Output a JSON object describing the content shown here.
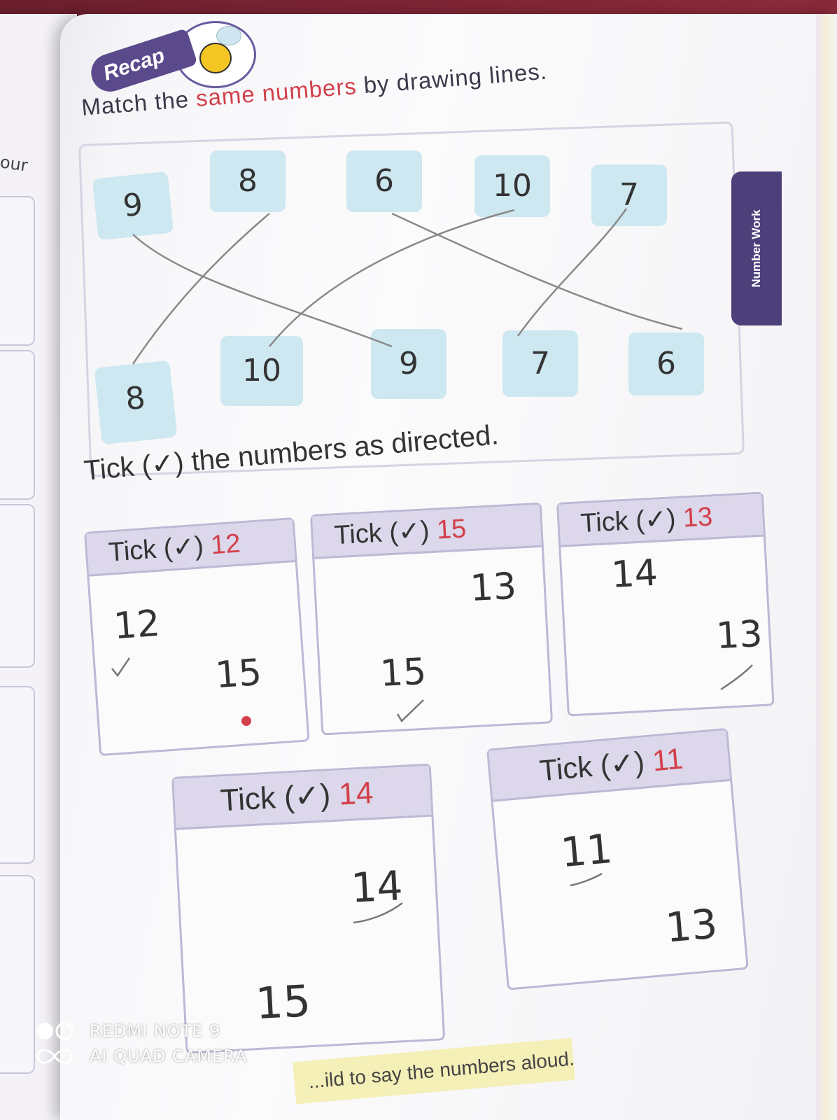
{
  "recap": {
    "label": "Recap"
  },
  "instruction": {
    "part1": "Match the ",
    "highlight": "same numbers",
    "part2": " by drawing lines."
  },
  "match_top": [
    "9",
    "8",
    "6",
    "10",
    "7"
  ],
  "match_bottom": [
    "8",
    "10",
    "9",
    "7",
    "6"
  ],
  "tick_title": "Tick (✓) the numbers as directed.",
  "tick_boxes": [
    {
      "head": "Tick (✓)",
      "target": "12",
      "numbers": [
        "12",
        "15"
      ]
    },
    {
      "head": "Tick (✓)",
      "target": "15",
      "numbers": [
        "13",
        "15"
      ]
    },
    {
      "head": "Tick (✓)",
      "target": "13",
      "numbers": [
        "14",
        "13"
      ]
    },
    {
      "head": "Tick (✓)",
      "target": "14",
      "numbers": [
        "14",
        "15"
      ]
    },
    {
      "head": "Tick (✓)",
      "target": "11",
      "numbers": [
        "11",
        "13"
      ]
    }
  ],
  "side_tab": "Number Work",
  "bottom_banner": "...ild to say the numbers aloud.",
  "left_page_text": "our",
  "watermark": {
    "line1": "REDMI NOTE 9",
    "line2": "AI QUAD CAMERA"
  }
}
